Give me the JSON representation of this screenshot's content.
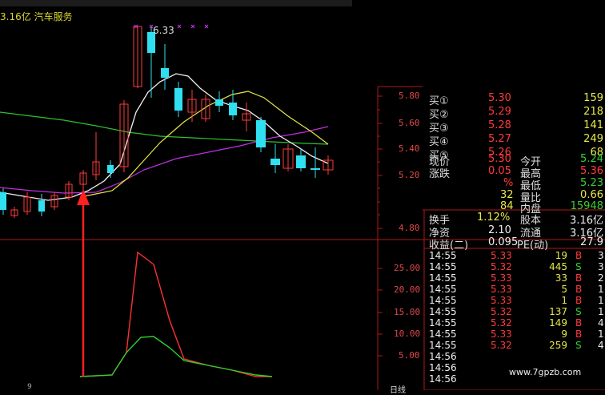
{
  "header": {
    "market_cap": "3.16亿",
    "sector": "汽车服务",
    "peak_label": "6.33"
  },
  "price_axis": [
    "5.80",
    "5.60",
    "5.40",
    "5.20",
    "4.80"
  ],
  "indicator_axis": [
    "25.00",
    "20.00",
    "15.00",
    "10.00",
    "5.00"
  ],
  "order_book": [
    {
      "label": "买①",
      "price": "5.30",
      "volume": "159"
    },
    {
      "label": "买②",
      "price": "5.29",
      "volume": "218"
    },
    {
      "label": "买③",
      "price": "5.28",
      "volume": "141"
    },
    {
      "label": "买④",
      "price": "5.27",
      "volume": "249"
    },
    {
      "label": "买⑤",
      "price": "5.26",
      "volume": "68"
    }
  ],
  "quote": {
    "current_label": "现价",
    "current": "5.30",
    "open_label": "今开",
    "open": "5.24",
    "change_label": "涨跌",
    "change": "0.05",
    "high_label": "最高",
    "high": "5.36",
    "change_pct": "%",
    "low_label": "最低",
    "low": "5.23",
    "qty_a": "32",
    "vol_ratio_label": "量比",
    "vol_ratio": "0.66",
    "qty_b": "84",
    "inner_label": "内盘",
    "inner": "15948"
  },
  "stats": {
    "turnover_label": "换手",
    "turnover": "1.12%",
    "equity_label": "股本",
    "equity": "3.16亿",
    "nav_label": "净资",
    "nav": "2.10",
    "float_label": "流通",
    "float": "3.16亿",
    "eps_label": "收益(二)",
    "eps": "0.095",
    "pe_label": "PE(动)",
    "pe": "27.9"
  },
  "trades": [
    {
      "time": "14:55",
      "price": "5.33",
      "volume": "19",
      "side": "B",
      "extra": "3"
    },
    {
      "time": "14:55",
      "price": "5.32",
      "volume": "445",
      "side": "S",
      "extra": "3"
    },
    {
      "time": "14:55",
      "price": "5.33",
      "volume": "33",
      "side": "B",
      "extra": "2"
    },
    {
      "time": "14:55",
      "price": "5.33",
      "volume": "5",
      "side": "B",
      "extra": "1"
    },
    {
      "time": "14:55",
      "price": "5.33",
      "volume": "1",
      "side": "B",
      "extra": "1"
    },
    {
      "time": "14:55",
      "price": "5.32",
      "volume": "137",
      "side": "S",
      "extra": "1"
    },
    {
      "time": "14:55",
      "price": "5.32",
      "volume": "149",
      "side": "B",
      "extra": "4"
    },
    {
      "time": "14:55",
      "price": "5.33",
      "volume": "9",
      "side": "B",
      "extra": "1"
    },
    {
      "time": "14:55",
      "price": "5.32",
      "volume": "259",
      "side": "S",
      "extra": "4"
    },
    {
      "time": "14:56",
      "price": "",
      "volume": "",
      "side": "",
      "extra": ""
    },
    {
      "time": "14:56",
      "price": "",
      "volume": "",
      "side": "",
      "extra": ""
    },
    {
      "time": "14:56",
      "price": "",
      "volume": "",
      "side": "",
      "extra": ""
    }
  ],
  "footer": {
    "tab": "日线",
    "watermark": "www.7gpzb.com",
    "bottom_left": "9"
  },
  "colors": {
    "up": "#ff3b3b",
    "down": "#30e0f0",
    "grid": "#b01818",
    "ma_white": "#f0f0f0",
    "ma_yellow": "#e8e84a",
    "ma_magenta": "#c030e0",
    "ma_green": "#30c030",
    "arrow": "#ff2020"
  }
}
